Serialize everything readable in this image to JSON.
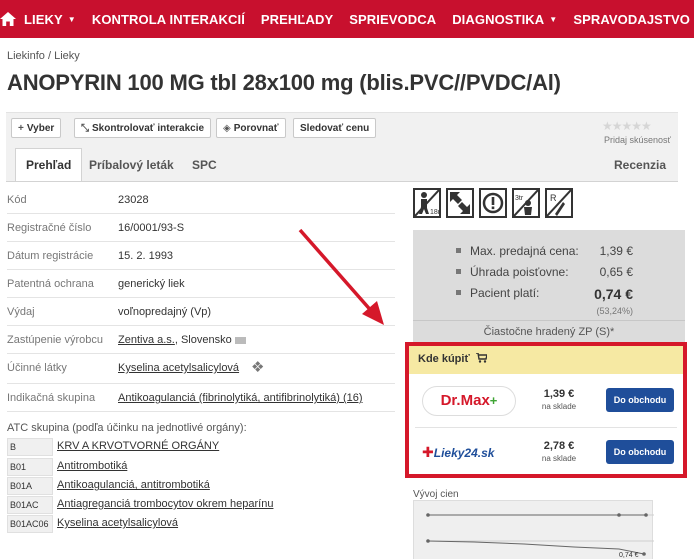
{
  "nav": {
    "items": [
      {
        "label": "LIEKY",
        "caret": "▼"
      },
      {
        "label": "KONTROLA INTERAKCIÍ",
        "caret": ""
      },
      {
        "label": "PREHĽADY",
        "caret": ""
      },
      {
        "label": "SPRIEVODCA",
        "caret": ""
      },
      {
        "label": "DIAGNOSTIKA",
        "caret": "▼"
      },
      {
        "label": "SPRAVODAJSTVO",
        "caret": "▼"
      }
    ]
  },
  "breadcrumb": "Liekinfo / Lieky",
  "title": "ANOPYRIN 100 MG tbl 28x100 mg (blis.PVC//PVDC/Al)",
  "toolbar": {
    "select": "Vyber",
    "check": "Skontrolovať interakcie",
    "compare": "Porovnať",
    "track": "Sledovať cenu",
    "stars": "★★★★★",
    "rating_label": "Pridaj skúsenosť"
  },
  "tabs": {
    "overview": "Prehľad",
    "leaflet": "Príbalový leták",
    "spc": "SPC",
    "reviews": "Recenzia"
  },
  "info": {
    "code_label": "Kód",
    "code": "23028",
    "reg_label": "Registračné číslo",
    "reg": "16/0001/93-S",
    "date_label": "Dátum registrácie",
    "date": "15. 2. 1993",
    "patent_label": "Patentná ochrana",
    "patent": "generický liek",
    "dispense_label": "Výdaj",
    "dispense": "voľnopredajný (Vp)",
    "maker_label": "Zastúpenie výrobcu",
    "maker": "Zentiva a.s.",
    "country": ", Slovensko",
    "substance_label": "Účinné látky",
    "substance": "Kyselina acetylsalicylová",
    "indication_label": "Indikačná skupina",
    "indication": "Antikoagulanciá (fibrinolytiká, antifibrinolytiká) (16)"
  },
  "atc": {
    "label": "ATC skupina (podľa účinku na jednotlivé orgány):",
    "rows": [
      {
        "code": "B",
        "name": "KRV A KRVOTVORNÉ ORGÁNY"
      },
      {
        "code": "B01",
        "name": "Antitrombotiká"
      },
      {
        "code": "B01A",
        "name": "Antikoagulanciá, antitrombotiká"
      },
      {
        "code": "B01AC",
        "name": "Antiagreganciá trombocytov okrem heparínu"
      },
      {
        "code": "B01AC06",
        "name": "Kyselina acetylsalicylová"
      }
    ]
  },
  "pictograms": [
    "18r",
    "3tr",
    "R"
  ],
  "price": {
    "max_label": "Max. predajná cena:",
    "max": "1,39 €",
    "refund_label": "Úhrada poisťovne:",
    "refund": "0,65 €",
    "patient_label": "Pacient platí:",
    "patient": "0,74 €",
    "patient_pct": "(53,24%)",
    "note": "Čiastočne hradený ZP (S)*"
  },
  "buy": {
    "title": "Kde kúpiť",
    "shops": [
      {
        "logo": "Dr.Max",
        "price": "1,39 €",
        "stock": "na sklade",
        "button": "Do obchodu"
      },
      {
        "logo": "Lieky24.sk",
        "price": "2,78 €",
        "stock": "na sklade",
        "button": "Do obchodu"
      }
    ]
  },
  "chart": {
    "title": "Vývoj cien",
    "last_value": "0,74 €"
  },
  "colors": {
    "brand": "#c8102e",
    "button": "#1f4e9a",
    "highlight": "#d5182a"
  }
}
